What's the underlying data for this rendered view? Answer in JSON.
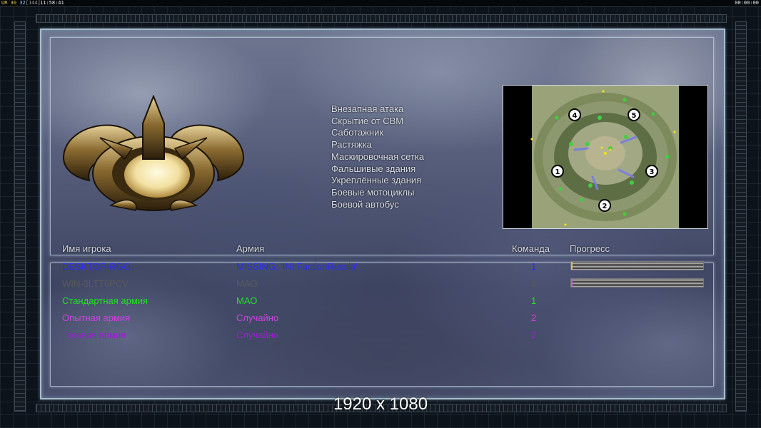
{
  "hud": {
    "fps_1": "UR",
    "fps_2": "30",
    "fps_3": "32",
    "fps_4": "[144]",
    "clock": "11:58:41",
    "timer": "00:00:00"
  },
  "rules": [
    "Внезапная атака",
    "Скрытие от СВМ",
    "Саботажник",
    "Растяжка",
    "Маскировочная сетка",
    "Фальшивые здания",
    "Укреплённые здания",
    "Боевые мотоциклы",
    "Боевой автобус"
  ],
  "minimap": {
    "start_positions": [
      "1",
      "2",
      "3",
      "4",
      "5"
    ]
  },
  "table": {
    "headers": {
      "player": "Имя игрока",
      "army": "Армия",
      "team": "Команда",
      "progress": "Прогресс"
    },
    "rows": [
      {
        "player": "DESKTOP-RGO",
        "army": "MISSING: 'INI:FactionRussia'",
        "team": "1",
        "color": "#2a2cf0",
        "progress": 0.01,
        "progress_color": "#d8c070"
      },
      {
        "player": "WIN-6LTT0PCV",
        "army": "МАО",
        "team": "1",
        "color": "#5a5a5a",
        "progress": 0.01,
        "progress_color": "#c060d0"
      },
      {
        "player": "Стандартная армия",
        "army": "МАО",
        "team": "1",
        "color": "#22e022"
      },
      {
        "player": "Опытная армия",
        "army": "Случайно",
        "team": "2",
        "color": "#d040e0"
      },
      {
        "player": "Грозная армия",
        "army": "Случайно",
        "team": "2",
        "color": "#9a1fd0"
      }
    ]
  },
  "resolution": "1920 x 1080"
}
